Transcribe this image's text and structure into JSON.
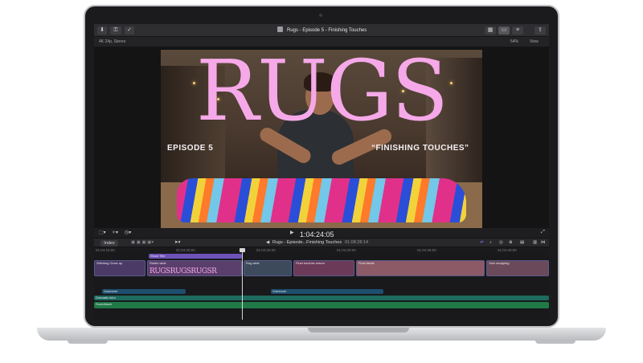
{
  "window": {
    "project_title": "Rugs - Episode 5 - Finishing Touches",
    "format_info": "4K 24p, Stereo",
    "zoom": "54%",
    "view_menu": "View"
  },
  "viewer": {
    "title_word": "RUGS",
    "episode_left": "EPISODE 5",
    "episode_right": "“FINISHING TOUCHES”",
    "timecode": "1:04:24:05"
  },
  "timeline": {
    "index_label": "Index",
    "project_label": "Rugs - Episode...Finishing Touches",
    "duration": "01:08:28:14",
    "ruler_marks": [
      "01:04:15:00",
      "01:04:20:00",
      "01:04:25:00",
      "01:04:30:00",
      "01:04:35:00",
      "01:04:40:00",
      "01:04:45:00"
    ],
    "title_clip": "Show Title",
    "clip_labels": [
      "Stitching Close up",
      "Studio wide",
      "Rug wide",
      "Final touches macro",
      "Final detail",
      "Yarn wrapping"
    ],
    "audio_clips": [
      "Voiceover",
      "Voiceover",
      "Dramatic intro",
      "Soundtrack"
    ],
    "logo_strip_text": "RUGSRUGSRUGSR"
  },
  "colors": {
    "accent_pink": "#f6a9e8",
    "title_clip": "#6e52b8",
    "audio_blue": "#1f4f6f",
    "audio_teal": "#1d6a5e",
    "audio_green": "#1f7a48"
  }
}
